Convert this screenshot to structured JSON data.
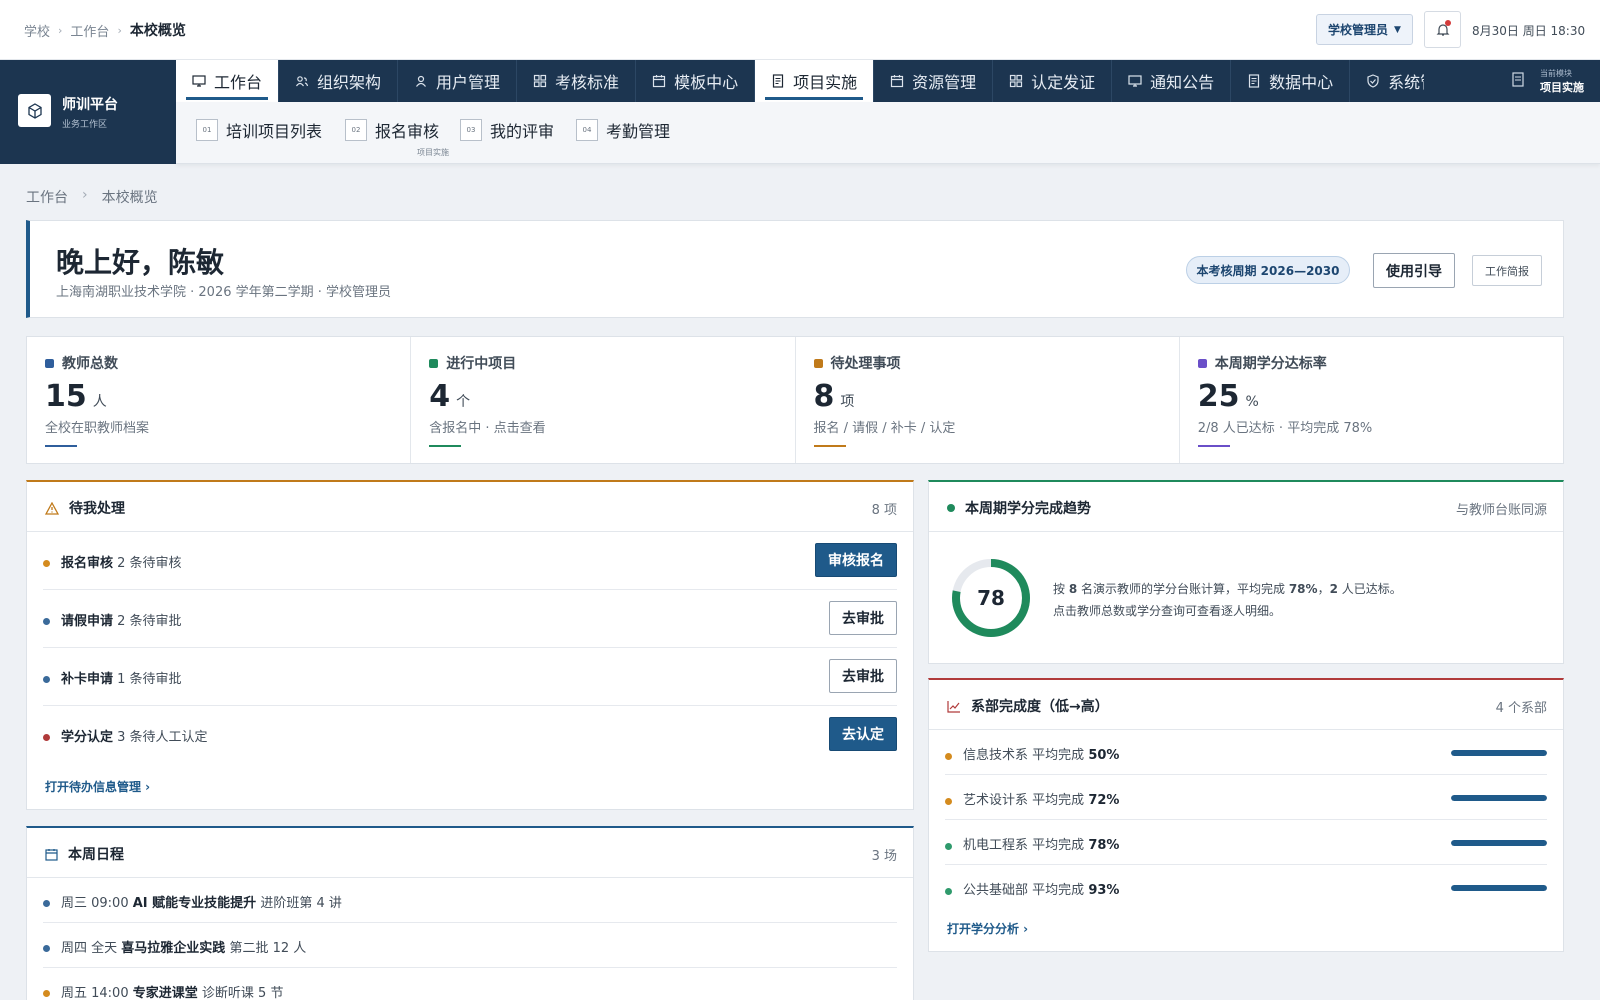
{
  "topbar": {
    "crumbs": [
      "学校",
      "工作台",
      "本校概览"
    ],
    "role": "学校管理员",
    "datetime": "8月30日 周日 18:30"
  },
  "brand": {
    "title": "师训平台",
    "subtitle": "业务工作区"
  },
  "nav": {
    "tabs": [
      {
        "label": "工作台",
        "icon": "monitor-icon",
        "active": true
      },
      {
        "label": "组织架构",
        "icon": "users-icon",
        "active": false
      },
      {
        "label": "用户管理",
        "icon": "user-icon",
        "active": false
      },
      {
        "label": "考核标准",
        "icon": "grid-icon",
        "active": false
      },
      {
        "label": "模板中心",
        "icon": "calendar-icon",
        "active": false
      },
      {
        "label": "项目实施",
        "icon": "document-icon",
        "active": true
      },
      {
        "label": "资源管理",
        "icon": "calendar-icon",
        "active": false
      },
      {
        "label": "认定发证",
        "icon": "grid-icon",
        "active": false
      },
      {
        "label": "通知公告",
        "icon": "monitor-icon",
        "active": false
      },
      {
        "label": "数据中心",
        "icon": "document-icon",
        "active": false
      },
      {
        "label": "系统管理",
        "icon": "shield-icon",
        "active": false
      }
    ],
    "current_module_label": "当前模块",
    "current_module": "项目实施"
  },
  "subnav": {
    "items": [
      {
        "num": "01",
        "label": "培训项目列表"
      },
      {
        "num": "02",
        "label": "报名审核"
      },
      {
        "num": "03",
        "label": "我的评审"
      },
      {
        "num": "04",
        "label": "考勤管理"
      }
    ],
    "hint": "项目实施"
  },
  "page_crumbs": [
    "工作台",
    "本校概览"
  ],
  "welcome": {
    "greeting": "晚上好，陈敏",
    "subtitle": "上海南湖职业技术学院 · 2026 学年第二学期 · 学校管理员",
    "period": "本考核周期 2026—2030",
    "guide": "使用引导",
    "brief": "工作简报"
  },
  "stats": [
    {
      "label": "教师总数",
      "value": "15",
      "unit": "人",
      "desc": "全校在职教师档案",
      "color": "#2f5e9c"
    },
    {
      "label": "进行中项目",
      "value": "4",
      "unit": "个",
      "desc": "含报名中 · 点击查看",
      "color": "#1f8a5c"
    },
    {
      "label": "待处理事项",
      "value": "8",
      "unit": "项",
      "desc": "报名 / 请假 / 补卡 / 认定",
      "color": "#c07a1a"
    },
    {
      "label": "本周期学分达标率",
      "value": "25",
      "unit": "%",
      "desc": "2/8 人已达标 · 平均完成 78%",
      "color": "#6a4fc8"
    }
  ],
  "todo": {
    "title": "待我处理",
    "count": "8 项",
    "items": [
      {
        "name": "报名审核",
        "detail": "2 条待审核",
        "action": "审核报名",
        "primary": true,
        "color": "#d48b1e"
      },
      {
        "name": "请假申请",
        "detail": "2 条待审批",
        "action": "去审批",
        "primary": false,
        "color": "#3a6a9a"
      },
      {
        "name": "补卡申请",
        "detail": "1 条待审批",
        "action": "去审批",
        "primary": false,
        "color": "#3a6a9a"
      },
      {
        "name": "学分认定",
        "detail": "3 条待人工认定",
        "action": "去认定",
        "primary": true,
        "color": "#b03a3a"
      }
    ],
    "link": "打开待办信息管理 ›"
  },
  "schedule": {
    "title": "本周日程",
    "count": "3 场",
    "items": [
      {
        "time": "周三 09:00",
        "name": "AI 赋能专业技能提升",
        "detail": "进阶班第 4 讲",
        "color": "#3a6a9a"
      },
      {
        "time": "周四 全天",
        "name": "喜马拉雅企业实践",
        "detail": "第二批 12 人",
        "color": "#3a6a9a"
      },
      {
        "time": "周五 14:00",
        "name": "专家进课堂",
        "detail": "诊断听课 5 节",
        "color": "#d48b1e"
      }
    ]
  },
  "trend": {
    "title": "本周期学分完成趋势",
    "meta": "与教师台账同源",
    "percent": 78,
    "percent_label": "78",
    "line1_a": "按 ",
    "line1_b": "8",
    "line1_c": " 名演示教师的学分台账计算，平均完成 ",
    "line1_d": "78%",
    "line1_e": "，",
    "line1_f": "2",
    "line1_g": " 人已达标。",
    "line2": "点击教师总数或学分查询可查看逐人明细。"
  },
  "dept": {
    "title": "系部完成度（低→高）",
    "count": "4 个系部",
    "items": [
      {
        "name": "信息技术系",
        "label": "平均完成",
        "value": "50%",
        "pct": 50,
        "color": "#d48b1e"
      },
      {
        "name": "艺术设计系",
        "label": "平均完成",
        "value": "72%",
        "pct": 72,
        "color": "#d48b1e"
      },
      {
        "name": "机电工程系",
        "label": "平均完成",
        "value": "78%",
        "pct": 78,
        "color": "#2f9a6c"
      },
      {
        "name": "公共基础部",
        "label": "平均完成",
        "value": "93%",
        "pct": 93,
        "color": "#2f9a6c"
      }
    ],
    "link": "打开学分分析 ›"
  }
}
